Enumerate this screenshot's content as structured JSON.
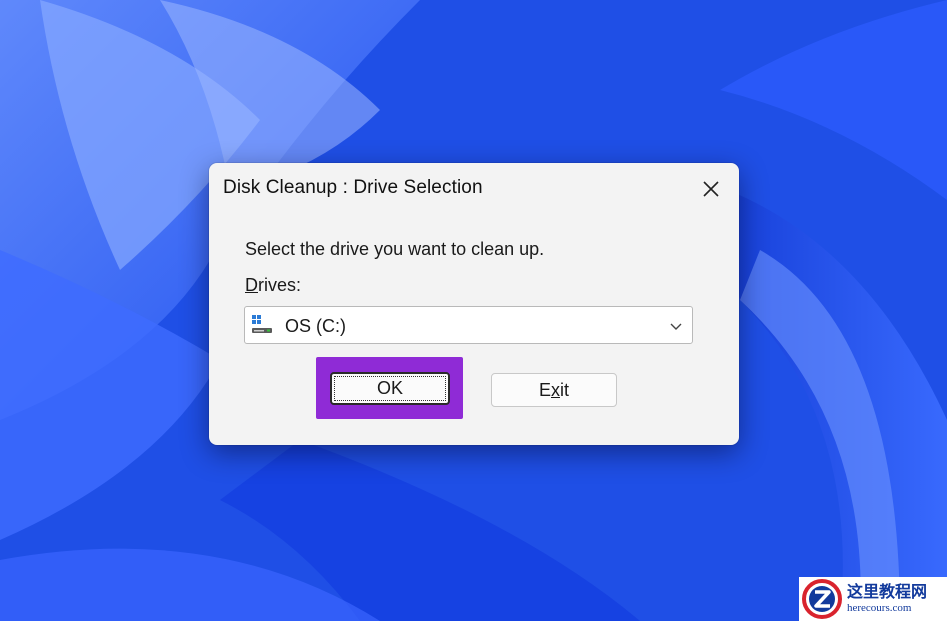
{
  "desktop": {
    "wallpaper": "windows-11-bloom-icon",
    "colors": {
      "base": "#1f4fe6",
      "light": "#5c86ff",
      "dark": "#0b28b8"
    }
  },
  "dialog": {
    "title": "Disk Cleanup : Drive Selection",
    "close_icon": "close-icon",
    "prompt": "Select the drive you want to clean up.",
    "drives_label": {
      "accel": "D",
      "rest": "rives:"
    },
    "drive_select": {
      "value": "OS (C:)",
      "icon": "drive-icon",
      "chevron": "chevron-down-icon"
    },
    "ok_button": "OK",
    "exit_button": {
      "before": "E",
      "accel": "x",
      "after": "it"
    },
    "highlight_color": "#8f2bd6"
  },
  "watermark": {
    "logo": "z-logo-icon",
    "text_cn": "这里教程网",
    "text_en": "herecours.com"
  }
}
